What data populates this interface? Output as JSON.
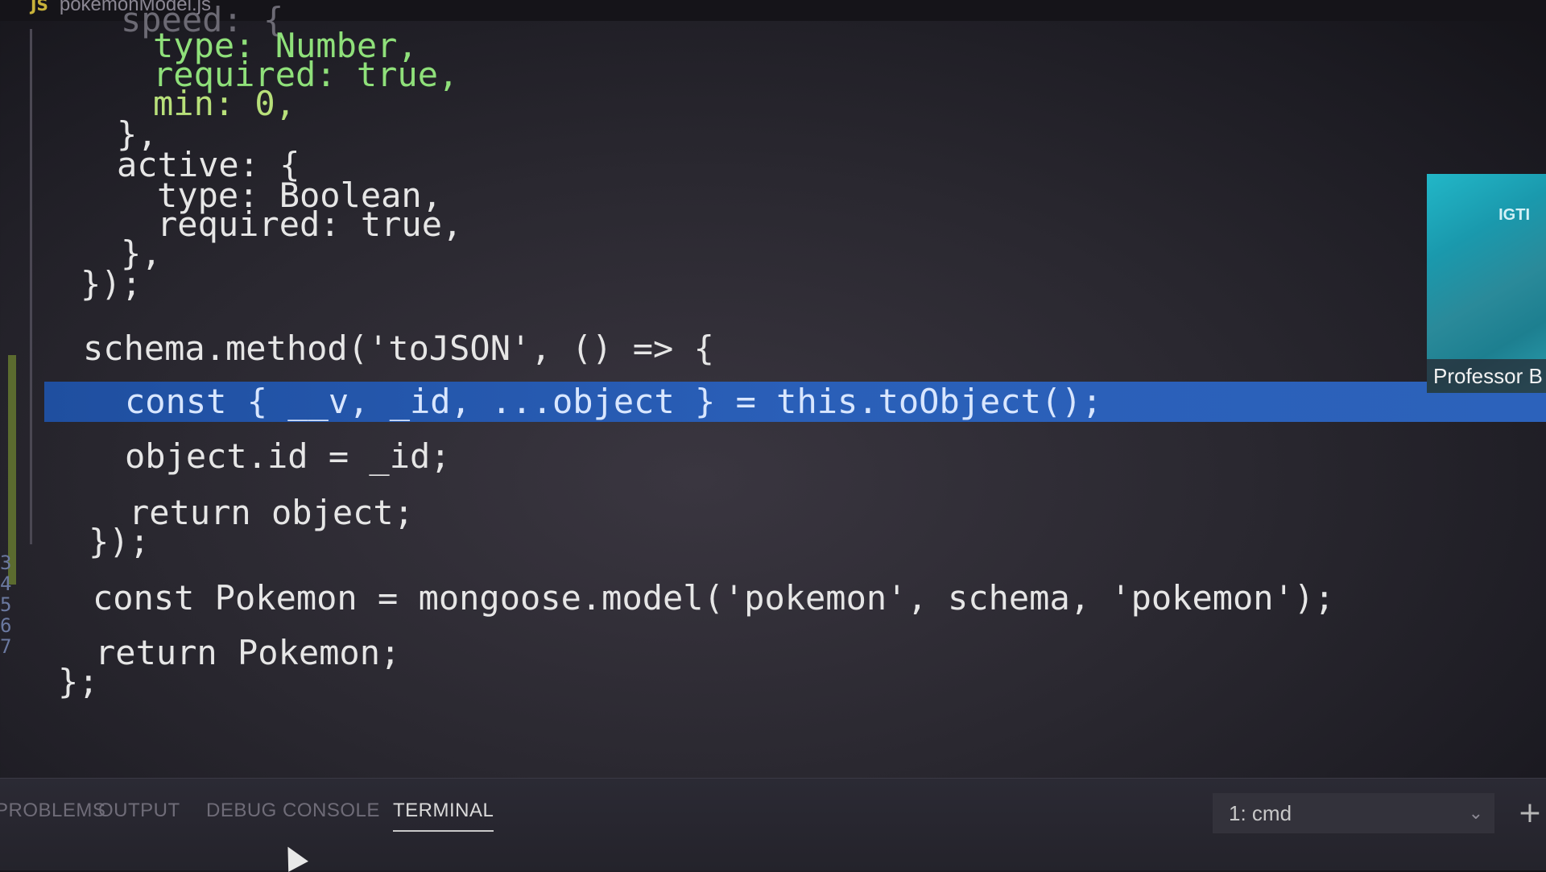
{
  "tab": {
    "icon": "JS",
    "filename": "pokemonModel.js"
  },
  "code_lines": [
    "speed: {",
    "type: Number,",
    "required: true,",
    "min: 0,",
    "},",
    "active: {",
    "type: Boolean,",
    "required: true,",
    "},",
    "});",
    "schema.method('toJSON', () => {",
    "const { __v, _id, ...object } = this.toObject();",
    "object.id = _id;",
    "return object;",
    "});",
    "const Pokemon = mongoose.model('pokemon', schema, 'pokemon');",
    "return Pokemon;",
    "};"
  ],
  "line_numbers": [
    "3",
    "4",
    "5",
    "6",
    "7"
  ],
  "thumbnail": {
    "logo": "IGTI",
    "caption": "Professor B"
  },
  "panel": {
    "tabs": [
      "PROBLEMS",
      "OUTPUT",
      "DEBUG CONSOLE",
      "TERMINAL"
    ],
    "active_tab": "TERMINAL",
    "terminal_select": "1: cmd",
    "add_label": "+"
  },
  "colors": {
    "keyword": "#5aa8e6",
    "selection": "#2a5fb8",
    "number": "#b8e07a"
  }
}
